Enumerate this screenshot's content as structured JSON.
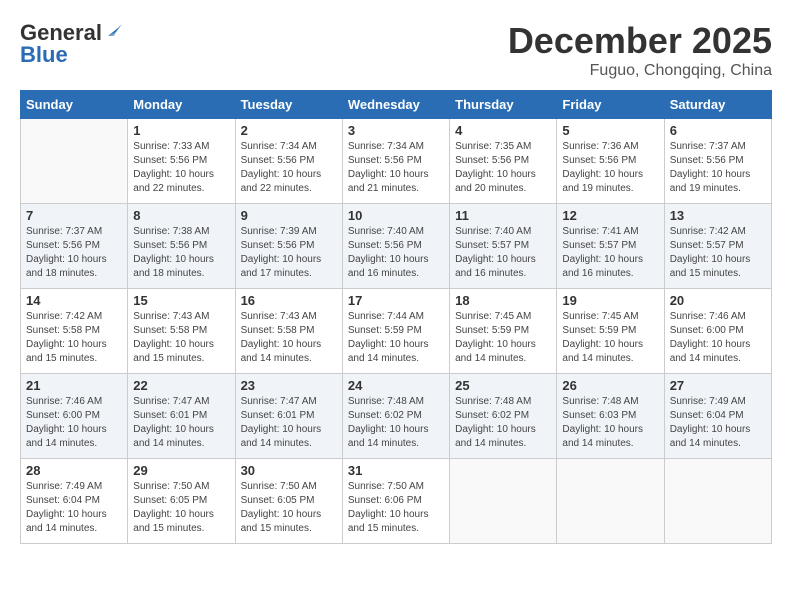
{
  "header": {
    "logo_general": "General",
    "logo_blue": "Blue",
    "month_title": "December 2025",
    "location": "Fuguo, Chongqing, China"
  },
  "days_of_week": [
    "Sunday",
    "Monday",
    "Tuesday",
    "Wednesday",
    "Thursday",
    "Friday",
    "Saturday"
  ],
  "weeks": [
    [
      {
        "day": "",
        "sunrise": "",
        "sunset": "",
        "daylight": ""
      },
      {
        "day": "1",
        "sunrise": "Sunrise: 7:33 AM",
        "sunset": "Sunset: 5:56 PM",
        "daylight": "Daylight: 10 hours and 22 minutes."
      },
      {
        "day": "2",
        "sunrise": "Sunrise: 7:34 AM",
        "sunset": "Sunset: 5:56 PM",
        "daylight": "Daylight: 10 hours and 22 minutes."
      },
      {
        "day": "3",
        "sunrise": "Sunrise: 7:34 AM",
        "sunset": "Sunset: 5:56 PM",
        "daylight": "Daylight: 10 hours and 21 minutes."
      },
      {
        "day": "4",
        "sunrise": "Sunrise: 7:35 AM",
        "sunset": "Sunset: 5:56 PM",
        "daylight": "Daylight: 10 hours and 20 minutes."
      },
      {
        "day": "5",
        "sunrise": "Sunrise: 7:36 AM",
        "sunset": "Sunset: 5:56 PM",
        "daylight": "Daylight: 10 hours and 19 minutes."
      },
      {
        "day": "6",
        "sunrise": "Sunrise: 7:37 AM",
        "sunset": "Sunset: 5:56 PM",
        "daylight": "Daylight: 10 hours and 19 minutes."
      }
    ],
    [
      {
        "day": "7",
        "sunrise": "Sunrise: 7:37 AM",
        "sunset": "Sunset: 5:56 PM",
        "daylight": "Daylight: 10 hours and 18 minutes."
      },
      {
        "day": "8",
        "sunrise": "Sunrise: 7:38 AM",
        "sunset": "Sunset: 5:56 PM",
        "daylight": "Daylight: 10 hours and 18 minutes."
      },
      {
        "day": "9",
        "sunrise": "Sunrise: 7:39 AM",
        "sunset": "Sunset: 5:56 PM",
        "daylight": "Daylight: 10 hours and 17 minutes."
      },
      {
        "day": "10",
        "sunrise": "Sunrise: 7:40 AM",
        "sunset": "Sunset: 5:56 PM",
        "daylight": "Daylight: 10 hours and 16 minutes."
      },
      {
        "day": "11",
        "sunrise": "Sunrise: 7:40 AM",
        "sunset": "Sunset: 5:57 PM",
        "daylight": "Daylight: 10 hours and 16 minutes."
      },
      {
        "day": "12",
        "sunrise": "Sunrise: 7:41 AM",
        "sunset": "Sunset: 5:57 PM",
        "daylight": "Daylight: 10 hours and 16 minutes."
      },
      {
        "day": "13",
        "sunrise": "Sunrise: 7:42 AM",
        "sunset": "Sunset: 5:57 PM",
        "daylight": "Daylight: 10 hours and 15 minutes."
      }
    ],
    [
      {
        "day": "14",
        "sunrise": "Sunrise: 7:42 AM",
        "sunset": "Sunset: 5:58 PM",
        "daylight": "Daylight: 10 hours and 15 minutes."
      },
      {
        "day": "15",
        "sunrise": "Sunrise: 7:43 AM",
        "sunset": "Sunset: 5:58 PM",
        "daylight": "Daylight: 10 hours and 15 minutes."
      },
      {
        "day": "16",
        "sunrise": "Sunrise: 7:43 AM",
        "sunset": "Sunset: 5:58 PM",
        "daylight": "Daylight: 10 hours and 14 minutes."
      },
      {
        "day": "17",
        "sunrise": "Sunrise: 7:44 AM",
        "sunset": "Sunset: 5:59 PM",
        "daylight": "Daylight: 10 hours and 14 minutes."
      },
      {
        "day": "18",
        "sunrise": "Sunrise: 7:45 AM",
        "sunset": "Sunset: 5:59 PM",
        "daylight": "Daylight: 10 hours and 14 minutes."
      },
      {
        "day": "19",
        "sunrise": "Sunrise: 7:45 AM",
        "sunset": "Sunset: 5:59 PM",
        "daylight": "Daylight: 10 hours and 14 minutes."
      },
      {
        "day": "20",
        "sunrise": "Sunrise: 7:46 AM",
        "sunset": "Sunset: 6:00 PM",
        "daylight": "Daylight: 10 hours and 14 minutes."
      }
    ],
    [
      {
        "day": "21",
        "sunrise": "Sunrise: 7:46 AM",
        "sunset": "Sunset: 6:00 PM",
        "daylight": "Daylight: 10 hours and 14 minutes."
      },
      {
        "day": "22",
        "sunrise": "Sunrise: 7:47 AM",
        "sunset": "Sunset: 6:01 PM",
        "daylight": "Daylight: 10 hours and 14 minutes."
      },
      {
        "day": "23",
        "sunrise": "Sunrise: 7:47 AM",
        "sunset": "Sunset: 6:01 PM",
        "daylight": "Daylight: 10 hours and 14 minutes."
      },
      {
        "day": "24",
        "sunrise": "Sunrise: 7:48 AM",
        "sunset": "Sunset: 6:02 PM",
        "daylight": "Daylight: 10 hours and 14 minutes."
      },
      {
        "day": "25",
        "sunrise": "Sunrise: 7:48 AM",
        "sunset": "Sunset: 6:02 PM",
        "daylight": "Daylight: 10 hours and 14 minutes."
      },
      {
        "day": "26",
        "sunrise": "Sunrise: 7:48 AM",
        "sunset": "Sunset: 6:03 PM",
        "daylight": "Daylight: 10 hours and 14 minutes."
      },
      {
        "day": "27",
        "sunrise": "Sunrise: 7:49 AM",
        "sunset": "Sunset: 6:04 PM",
        "daylight": "Daylight: 10 hours and 14 minutes."
      }
    ],
    [
      {
        "day": "28",
        "sunrise": "Sunrise: 7:49 AM",
        "sunset": "Sunset: 6:04 PM",
        "daylight": "Daylight: 10 hours and 14 minutes."
      },
      {
        "day": "29",
        "sunrise": "Sunrise: 7:50 AM",
        "sunset": "Sunset: 6:05 PM",
        "daylight": "Daylight: 10 hours and 15 minutes."
      },
      {
        "day": "30",
        "sunrise": "Sunrise: 7:50 AM",
        "sunset": "Sunset: 6:05 PM",
        "daylight": "Daylight: 10 hours and 15 minutes."
      },
      {
        "day": "31",
        "sunrise": "Sunrise: 7:50 AM",
        "sunset": "Sunset: 6:06 PM",
        "daylight": "Daylight: 10 hours and 15 minutes."
      },
      {
        "day": "",
        "sunrise": "",
        "sunset": "",
        "daylight": ""
      },
      {
        "day": "",
        "sunrise": "",
        "sunset": "",
        "daylight": ""
      },
      {
        "day": "",
        "sunrise": "",
        "sunset": "",
        "daylight": ""
      }
    ]
  ]
}
